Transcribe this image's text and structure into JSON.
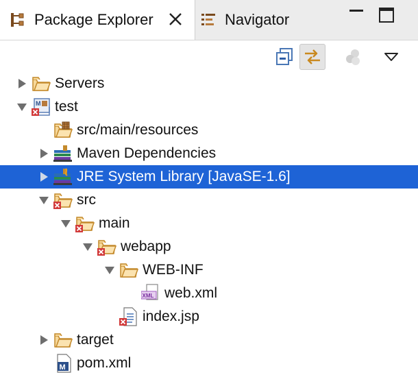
{
  "tabs": {
    "active_label": "Package Explorer",
    "inactive_label": "Navigator"
  },
  "tree": [
    {
      "label": "Servers",
      "icon": "folder-icon",
      "twisty": "collapsed",
      "depth": 0
    },
    {
      "label": "test",
      "icon": "maven-project-error-icon",
      "twisty": "expanded",
      "depth": 0
    },
    {
      "label": "src/main/resources",
      "icon": "package-folder-icon",
      "twisty": "none",
      "depth": 1
    },
    {
      "label": "Maven Dependencies",
      "icon": "library-icon",
      "twisty": "collapsed",
      "depth": 1
    },
    {
      "label": "JRE System Library [JavaSE-1.6]",
      "icon": "jre-library-icon",
      "twisty": "collapsed",
      "depth": 1,
      "selected": true
    },
    {
      "label": "src",
      "icon": "folder-error-icon",
      "twisty": "expanded",
      "depth": 1
    },
    {
      "label": "main",
      "icon": "folder-error-icon",
      "twisty": "expanded",
      "depth": 2
    },
    {
      "label": "webapp",
      "icon": "folder-error-icon",
      "twisty": "expanded",
      "depth": 3
    },
    {
      "label": "WEB-INF",
      "icon": "folder-icon",
      "twisty": "expanded",
      "depth": 4
    },
    {
      "label": "web.xml",
      "icon": "xml-file-icon",
      "twisty": "none",
      "depth": 5
    },
    {
      "label": "index.jsp",
      "icon": "jsp-file-error-icon",
      "twisty": "none",
      "depth": 4
    },
    {
      "label": "target",
      "icon": "folder-icon",
      "twisty": "collapsed",
      "depth": 1
    },
    {
      "label": "pom.xml",
      "icon": "maven-pom-icon",
      "twisty": "none",
      "depth": 1
    }
  ],
  "colors": {
    "selection": "#1e63d6",
    "folder": "#f3c77a",
    "error": "#d23a3a"
  }
}
